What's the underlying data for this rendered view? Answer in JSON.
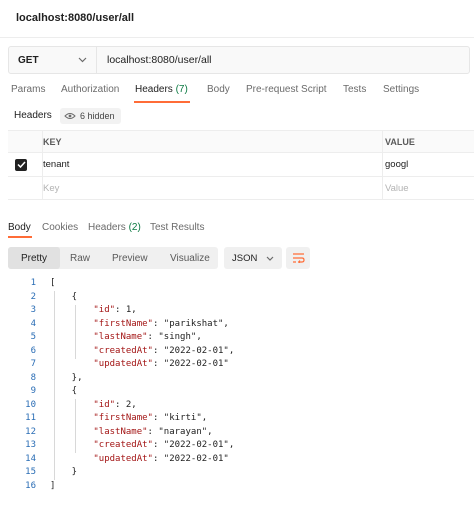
{
  "request": {
    "title": "localhost:8080/user/all",
    "method": "GET",
    "url": "localhost:8080/user/all"
  },
  "request_tabs": [
    {
      "label": "Params"
    },
    {
      "label": "Authorization"
    },
    {
      "label": "Headers",
      "count": "(7)",
      "active": true
    },
    {
      "label": "Body"
    },
    {
      "label": "Pre-request Script"
    },
    {
      "label": "Tests"
    },
    {
      "label": "Settings"
    }
  ],
  "headers_section": {
    "label": "Headers",
    "hidden_text": "6 hidden",
    "columns": {
      "key": "KEY",
      "value": "VALUE"
    },
    "rows": [
      {
        "key": "tenant",
        "value": "googl",
        "checked": true
      }
    ],
    "placeholder": {
      "key": "Key",
      "value": "Value"
    }
  },
  "response_tabs": [
    {
      "label": "Body",
      "active": true
    },
    {
      "label": "Cookies"
    },
    {
      "label": "Headers",
      "count": "(2)"
    },
    {
      "label": "Test Results"
    }
  ],
  "view_modes": [
    "Pretty",
    "Raw",
    "Preview",
    "Visualize"
  ],
  "active_view": "Pretty",
  "format": "JSON",
  "accent_color": "#ff6c37",
  "response_lines": [
    {
      "n": "1",
      "text": "["
    },
    {
      "n": "2",
      "text": "    {"
    },
    {
      "n": "3",
      "text": "        \"id\": 1,"
    },
    {
      "n": "4",
      "text": "        \"firstName\": \"parikshat\","
    },
    {
      "n": "5",
      "text": "        \"lastName\": \"singh\","
    },
    {
      "n": "6",
      "text": "        \"createdAt\": \"2022-02-01\","
    },
    {
      "n": "7",
      "text": "        \"updatedAt\": \"2022-02-01\""
    },
    {
      "n": "8",
      "text": "    },"
    },
    {
      "n": "9",
      "text": "    {"
    },
    {
      "n": "10",
      "text": "        \"id\": 2,"
    },
    {
      "n": "11",
      "text": "        \"firstName\": \"kirti\","
    },
    {
      "n": "12",
      "text": "        \"lastName\": \"narayan\","
    },
    {
      "n": "13",
      "text": "        \"createdAt\": \"2022-02-01\","
    },
    {
      "n": "14",
      "text": "        \"updatedAt\": \"2022-02-01\""
    },
    {
      "n": "15",
      "text": "    }"
    },
    {
      "n": "16",
      "text": "]"
    }
  ]
}
